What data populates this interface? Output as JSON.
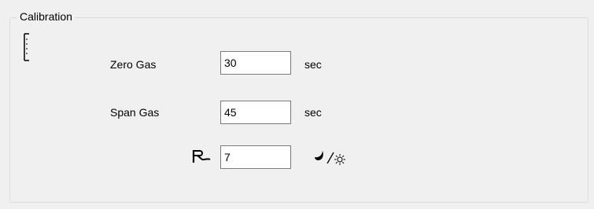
{
  "group": {
    "title": "Calibration"
  },
  "zero_gas": {
    "label": "Zero Gas",
    "value": "30",
    "unit": "sec"
  },
  "span_gas": {
    "label": "Span Gas",
    "value": "45",
    "unit": "sec"
  },
  "cycle": {
    "value": "7",
    "prefix_icon": "flag-symbol-icon",
    "suffix_icon": "night-day-icon"
  }
}
